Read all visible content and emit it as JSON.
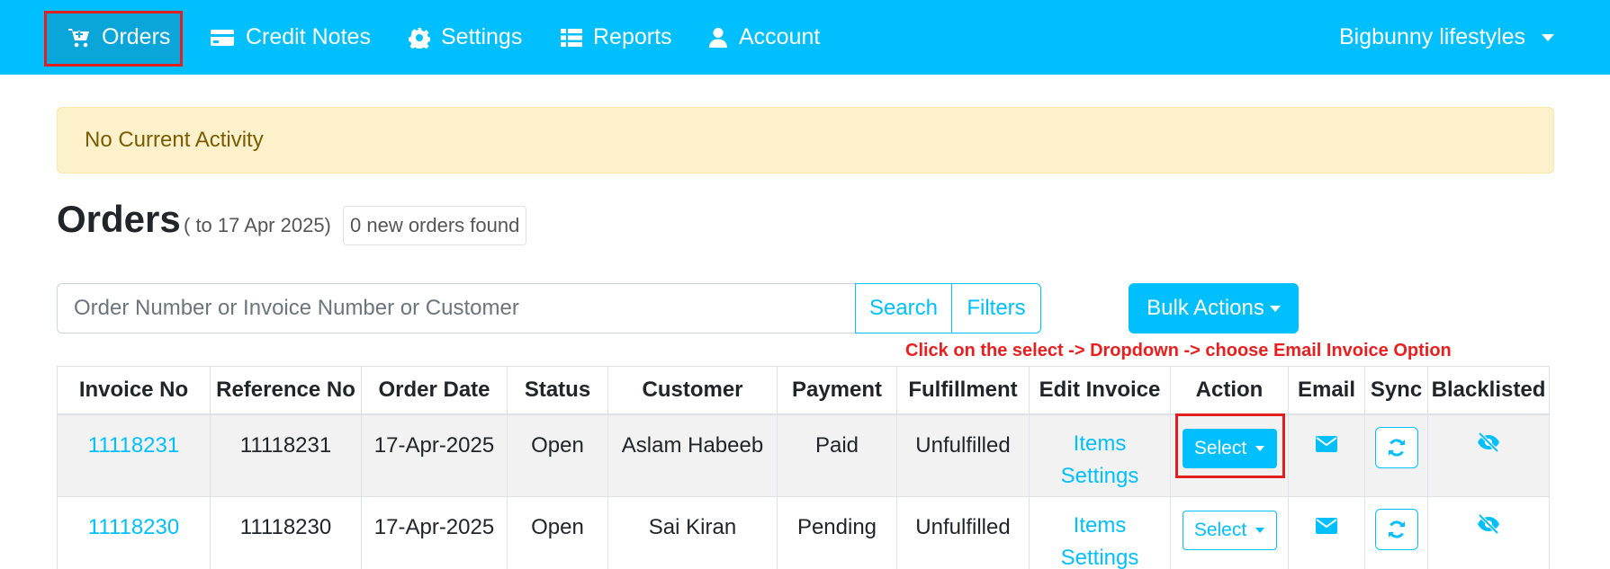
{
  "nav": {
    "items": [
      {
        "label": "Orders",
        "icon": "cart-icon"
      },
      {
        "label": "Credit Notes",
        "icon": "credit-card-icon"
      },
      {
        "label": "Settings",
        "icon": "gear-icon"
      },
      {
        "label": "Reports",
        "icon": "list-icon"
      },
      {
        "label": "Account",
        "icon": "user-icon"
      }
    ],
    "store_name": "Bigbunny lifestyles"
  },
  "alert": {
    "text": "No Current Activity"
  },
  "heading": {
    "title": "Orders",
    "date_range": "( to 17 Apr 2025)",
    "new_orders": "0 new orders found"
  },
  "search": {
    "placeholder": "Order Number or Invoice Number or Customer",
    "search_label": "Search",
    "filters_label": "Filters",
    "bulk_label": "Bulk Actions"
  },
  "annotation": "Click on the select -> Dropdown -> choose Email Invoice Option",
  "table": {
    "headers": [
      "Invoice No",
      "Reference No",
      "Order Date",
      "Status",
      "Customer",
      "Payment",
      "Fulfillment",
      "Edit Invoice",
      "Action",
      "Email",
      "Sync",
      "Blacklisted"
    ],
    "rows": [
      {
        "invoice": "11118231",
        "reference": "11118231",
        "date": "17-Apr-2025",
        "status": "Open",
        "customer": "Aslam Habeeb",
        "payment": "Paid",
        "fulfillment": "Unfulfilled",
        "items_link": "Items",
        "settings_link": "Settings",
        "action": "Select"
      },
      {
        "invoice": "11118230",
        "reference": "11118230",
        "date": "17-Apr-2025",
        "status": "Open",
        "customer": "Sai Kiran",
        "payment": "Pending",
        "fulfillment": "Unfulfilled",
        "items_link": "Items",
        "settings_link": "Settings",
        "action": "Select"
      }
    ]
  },
  "colors": {
    "primary": "#00bfff",
    "highlight_border": "#e02020",
    "alert_bg": "#fdf1cc",
    "alert_text": "#7a5c00",
    "annotation_text": "#e81f1f"
  }
}
